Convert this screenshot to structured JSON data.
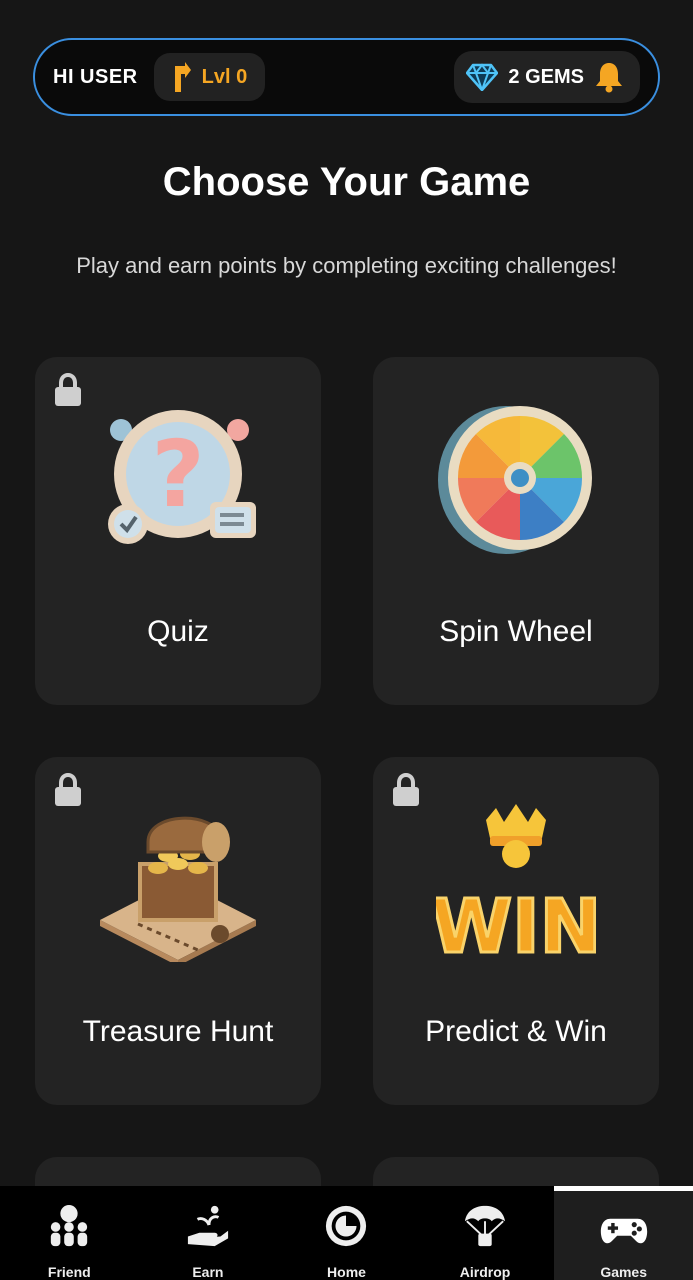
{
  "header": {
    "greeting": "HI USER",
    "level_label": "Lvl 0",
    "gems_label": "2 GEMS",
    "colors": {
      "border": "#3a8fe0",
      "level": "#f5a623",
      "gem": "#4fc3f7",
      "bell": "#f5a623"
    }
  },
  "page": {
    "title": "Choose Your Game",
    "subtitle": "Play and earn points by completing exciting challenges!"
  },
  "games": [
    {
      "name": "Quiz",
      "locked": true,
      "icon": "quiz-icon"
    },
    {
      "name": "Spin Wheel",
      "locked": false,
      "icon": "spin-wheel-icon"
    },
    {
      "name": "Treasure Hunt",
      "locked": true,
      "icon": "treasure-chest-icon"
    },
    {
      "name": "Predict & Win",
      "locked": true,
      "icon": "predict-win-icon"
    }
  ],
  "nav": {
    "items": [
      {
        "label": "Friend",
        "icon": "friends-icon"
      },
      {
        "label": "Earn",
        "icon": "earn-icon"
      },
      {
        "label": "Home",
        "icon": "home-icon"
      },
      {
        "label": "Airdrop",
        "icon": "airdrop-icon"
      },
      {
        "label": "Games",
        "icon": "gamepad-icon",
        "active": true
      }
    ]
  }
}
